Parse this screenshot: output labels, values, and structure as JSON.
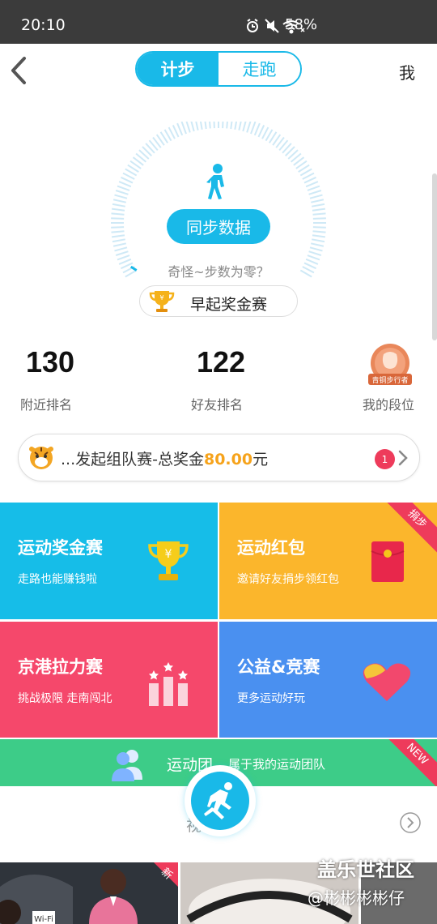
{
  "status_bar": {
    "time": "20:10",
    "battery": "58%"
  },
  "header": {
    "tabs": [
      {
        "label": "计步",
        "active": true
      },
      {
        "label": "走跑",
        "active": false
      }
    ],
    "me_label": "我"
  },
  "gauge": {
    "sync_label": "同步数据",
    "hint": "奇怪~步数为零？",
    "early_race_label": "早起奖金赛"
  },
  "stats": {
    "nearby_rank": "130",
    "nearby_label": "附近排名",
    "friend_rank": "122",
    "friend_label": "好友排名",
    "badge_text": "青铜步行者",
    "level_label": "我的段位"
  },
  "team_race": {
    "prefix": "...发起组队赛-总奖金",
    "amount": "80.00",
    "suffix": "元",
    "count": "1"
  },
  "tiles": [
    {
      "title": "运动奖金赛",
      "subtitle": "走路也能赚钱啦",
      "color": "#16bde8"
    },
    {
      "title": "运动红包",
      "subtitle": "邀请好友捐步领红包",
      "color": "#fbb62c",
      "ribbon": "捐步"
    },
    {
      "title": "京港拉力赛",
      "subtitle": "挑战极限 走南闯北",
      "color": "#f5486b"
    },
    {
      "title": "公益&竞赛",
      "subtitle": "更多运动好玩",
      "color": "#4a90f0"
    }
  ],
  "group": {
    "title": "运动团",
    "subtitle": "属于我的运动团队",
    "ribbon": "NEW",
    "color": "#3dcc88"
  },
  "section_peek": "视  题",
  "thumb_ribbon": "新",
  "watermark": {
    "line1": "盖乐世社区",
    "line2": "@彬彬彬彬仔"
  }
}
